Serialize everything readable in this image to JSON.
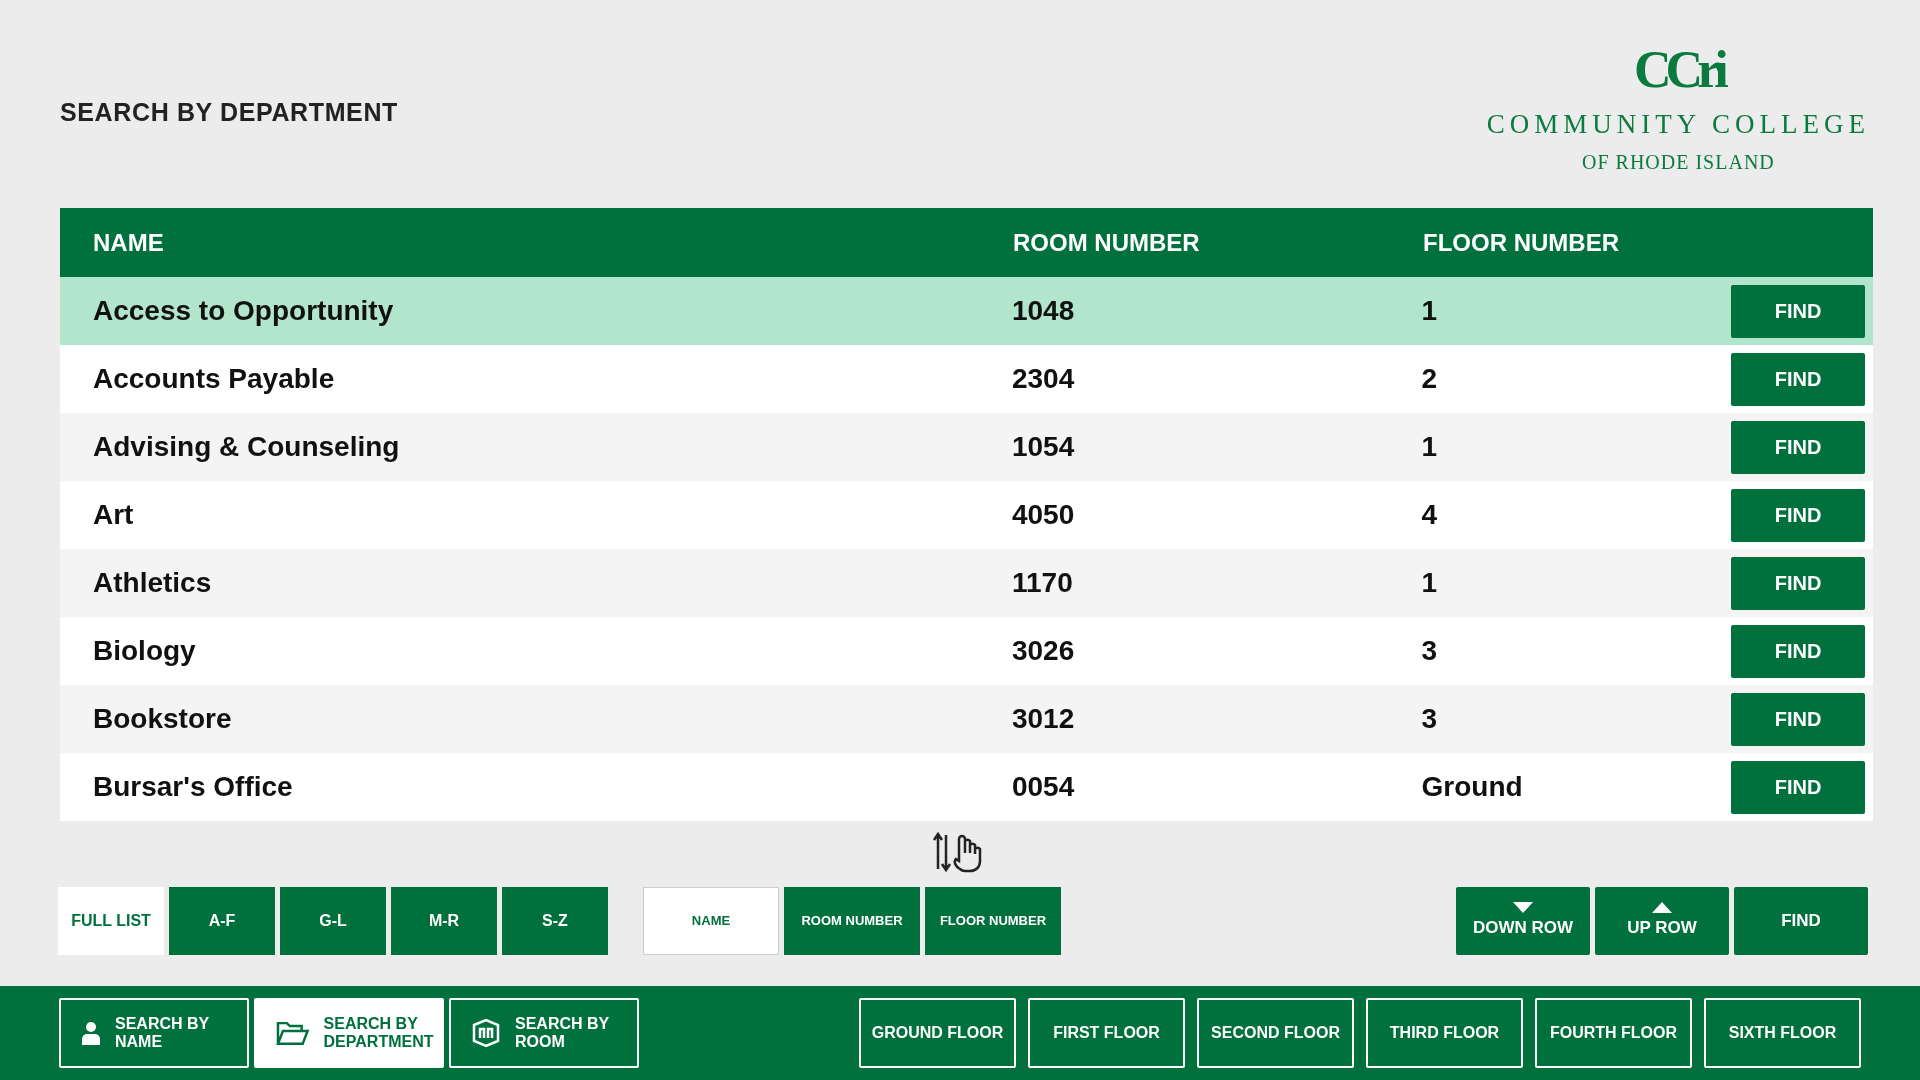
{
  "page_title": "SEARCH BY DEPARTMENT",
  "logo": {
    "mark": "CCri",
    "line_1": "COMMUNITY COLLEGE",
    "line_2": "OF RHODE ISLAND"
  },
  "table": {
    "columns": [
      "NAME",
      "ROOM NUMBER",
      "FLOOR NUMBER"
    ],
    "rows": [
      {
        "name": "Access to Opportunity",
        "room": "1048",
        "floor": "1",
        "action": "FIND",
        "selected": true
      },
      {
        "name": "Accounts Payable",
        "room": "2304",
        "floor": "2",
        "action": "FIND",
        "selected": false
      },
      {
        "name": "Advising & Counseling",
        "room": "1054",
        "floor": "1",
        "action": "FIND",
        "selected": false
      },
      {
        "name": "Art",
        "room": "4050",
        "floor": "4",
        "action": "FIND",
        "selected": false
      },
      {
        "name": "Athletics",
        "room": "1170",
        "floor": "1",
        "action": "FIND",
        "selected": false
      },
      {
        "name": "Biology",
        "room": "3026",
        "floor": "3",
        "action": "FIND",
        "selected": false
      },
      {
        "name": "Bookstore",
        "room": "3012",
        "floor": "3",
        "action": "FIND",
        "selected": false
      },
      {
        "name": "Bursar's Office",
        "room": "0054",
        "floor": "Ground",
        "action": "FIND",
        "selected": false
      }
    ]
  },
  "letter_filters": [
    {
      "label": "FULL LIST",
      "selected": true
    },
    {
      "label": "A-F",
      "selected": false
    },
    {
      "label": "G-L",
      "selected": false
    },
    {
      "label": "M-R",
      "selected": false
    },
    {
      "label": "S-Z",
      "selected": false
    }
  ],
  "sort_buttons": [
    {
      "label": "NAME",
      "selected": true
    },
    {
      "label": "ROOM NUMBER",
      "selected": false
    },
    {
      "label": "FLOOR NUMBER",
      "selected": false
    }
  ],
  "row_controls": [
    {
      "label": "DOWN ROW",
      "kind": "down"
    },
    {
      "label": "UP ROW",
      "kind": "up"
    },
    {
      "label": "FIND",
      "kind": "find"
    }
  ],
  "search_modes": [
    {
      "label": "SEARCH BY NAME",
      "kind": "person",
      "selected": false
    },
    {
      "label": "SEARCH BY DEPARTMENT",
      "kind": "folder",
      "selected": true
    },
    {
      "label": "SEARCH BY ROOM",
      "kind": "room",
      "selected": false
    }
  ],
  "floors": [
    "GROUND FLOOR",
    "FIRST FLOOR",
    "SECOND FLOOR",
    "THIRD FLOOR",
    "FOURTH FLOOR",
    "SIXTH FLOOR"
  ]
}
